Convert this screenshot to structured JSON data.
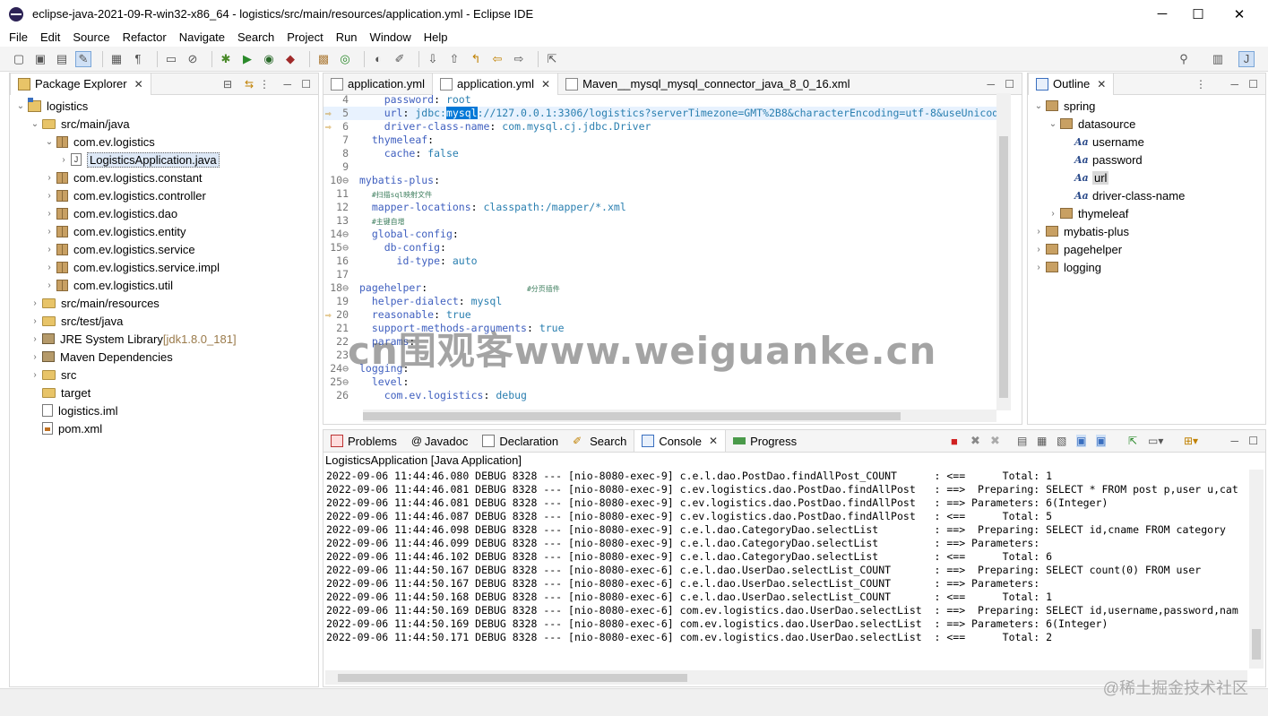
{
  "window": {
    "title": "eclipse-java-2021-09-R-win32-x86_64 - logistics/src/main/resources/application.yml - Eclipse IDE",
    "minimize": "─",
    "maximize": "☐",
    "close": "✕"
  },
  "menu": [
    "File",
    "Edit",
    "Source",
    "Refactor",
    "Navigate",
    "Search",
    "Project",
    "Run",
    "Window",
    "Help"
  ],
  "package_explorer": {
    "title": "Package Explorer",
    "tree": [
      {
        "label": "logistics",
        "kind": "project",
        "depth": 0,
        "twisty": "v"
      },
      {
        "label": "src/main/java",
        "kind": "srcfolder",
        "depth": 1,
        "twisty": "v"
      },
      {
        "label": "com.ev.logistics",
        "kind": "package",
        "depth": 2,
        "twisty": "v"
      },
      {
        "label": "LogisticsApplication.java",
        "kind": "java",
        "depth": 3,
        "twisty": ">",
        "selected": true
      },
      {
        "label": "com.ev.logistics.constant",
        "kind": "package",
        "depth": 2,
        "twisty": ">"
      },
      {
        "label": "com.ev.logistics.controller",
        "kind": "package",
        "depth": 2,
        "twisty": ">"
      },
      {
        "label": "com.ev.logistics.dao",
        "kind": "package",
        "depth": 2,
        "twisty": ">"
      },
      {
        "label": "com.ev.logistics.entity",
        "kind": "package",
        "depth": 2,
        "twisty": ">"
      },
      {
        "label": "com.ev.logistics.service",
        "kind": "package",
        "depth": 2,
        "twisty": ">"
      },
      {
        "label": "com.ev.logistics.service.impl",
        "kind": "package",
        "depth": 2,
        "twisty": ">"
      },
      {
        "label": "com.ev.logistics.util",
        "kind": "package",
        "depth": 2,
        "twisty": ">"
      },
      {
        "label": "src/main/resources",
        "kind": "srcfolder",
        "depth": 1,
        "twisty": ">"
      },
      {
        "label": "src/test/java",
        "kind": "srcfolder",
        "depth": 1,
        "twisty": ">"
      },
      {
        "label": "JRE System Library",
        "suffix": "[jdk1.8.0_181]",
        "kind": "jar",
        "depth": 1,
        "twisty": ">"
      },
      {
        "label": "Maven Dependencies",
        "kind": "jar",
        "depth": 1,
        "twisty": ">"
      },
      {
        "label": "src",
        "kind": "folder",
        "depth": 1,
        "twisty": ">"
      },
      {
        "label": "target",
        "kind": "folder",
        "depth": 1,
        "twisty": ""
      },
      {
        "label": "logistics.iml",
        "kind": "file",
        "depth": 1,
        "twisty": ""
      },
      {
        "label": "pom.xml",
        "kind": "xml",
        "depth": 1,
        "twisty": ""
      }
    ]
  },
  "editor": {
    "tabs": [
      {
        "label": "application.yml",
        "active": false
      },
      {
        "label": "application.yml",
        "active": true
      },
      {
        "label": "Maven__mysql_mysql_connector_java_8_0_16.xml",
        "active": false
      }
    ],
    "lines": [
      {
        "n": "4",
        "parts": [
          [
            "p",
            "    "
          ],
          [
            "k",
            "password"
          ],
          [
            "p",
            ": "
          ],
          [
            "v",
            "root"
          ]
        ]
      },
      {
        "n": "5",
        "marker": true,
        "parts": [
          [
            "p",
            "    "
          ],
          [
            "k",
            "url"
          ],
          [
            "p",
            ": "
          ],
          [
            "v",
            "jdbc:"
          ],
          [
            "hl",
            "mysql"
          ],
          [
            "v",
            "://127.0.0.1:3306/logistics?serverTimezone=GMT%2B8&characterEncoding=utf-8&useUnicode"
          ]
        ]
      },
      {
        "n": "6",
        "marker": true,
        "parts": [
          [
            "p",
            "    "
          ],
          [
            "k",
            "driver-class-name"
          ],
          [
            "p",
            ": "
          ],
          [
            "v",
            "com.mysql.cj.jdbc.Driver"
          ]
        ]
      },
      {
        "n": "7",
        "parts": [
          [
            "p",
            "  "
          ],
          [
            "k",
            "thymeleaf"
          ],
          [
            "p",
            ":"
          ]
        ]
      },
      {
        "n": "8",
        "parts": [
          [
            "p",
            "    "
          ],
          [
            "k",
            "cache"
          ],
          [
            "p",
            ": "
          ],
          [
            "v",
            "false"
          ]
        ]
      },
      {
        "n": "9",
        "parts": []
      },
      {
        "n": "10⊖",
        "parts": [
          [
            "k",
            "mybatis-plus"
          ],
          [
            "p",
            ":"
          ]
        ]
      },
      {
        "n": "11",
        "parts": [
          [
            "p",
            "  "
          ],
          [
            "c",
            "#扫描sql映射文件"
          ]
        ]
      },
      {
        "n": "12",
        "parts": [
          [
            "p",
            "  "
          ],
          [
            "k",
            "mapper-locations"
          ],
          [
            "p",
            ": "
          ],
          [
            "v",
            "classpath:/mapper/*.xml"
          ]
        ]
      },
      {
        "n": "13",
        "parts": [
          [
            "p",
            "  "
          ],
          [
            "c",
            "#主键自增"
          ]
        ]
      },
      {
        "n": "14⊖",
        "parts": [
          [
            "p",
            "  "
          ],
          [
            "k",
            "global-config"
          ],
          [
            "p",
            ":"
          ]
        ]
      },
      {
        "n": "15⊖",
        "parts": [
          [
            "p",
            "    "
          ],
          [
            "k",
            "db-config"
          ],
          [
            "p",
            ":"
          ]
        ]
      },
      {
        "n": "16",
        "parts": [
          [
            "p",
            "      "
          ],
          [
            "k",
            "id-type"
          ],
          [
            "p",
            ": "
          ],
          [
            "v",
            "auto"
          ]
        ]
      },
      {
        "n": "17",
        "parts": []
      },
      {
        "n": "18⊖",
        "parts": [
          [
            "k",
            "pagehelper"
          ],
          [
            "p",
            ":                "
          ],
          [
            "c",
            "#分页插件"
          ]
        ]
      },
      {
        "n": "19",
        "parts": [
          [
            "p",
            "  "
          ],
          [
            "k",
            "helper-dialect"
          ],
          [
            "p",
            ": "
          ],
          [
            "v",
            "mysql"
          ]
        ]
      },
      {
        "n": "20",
        "marker": true,
        "parts": [
          [
            "p",
            "  "
          ],
          [
            "k",
            "reasonable"
          ],
          [
            "p",
            ": "
          ],
          [
            "v",
            "true"
          ]
        ]
      },
      {
        "n": "21",
        "parts": [
          [
            "p",
            "  "
          ],
          [
            "k",
            "support-methods-arguments"
          ],
          [
            "p",
            ": "
          ],
          [
            "v",
            "true"
          ]
        ]
      },
      {
        "n": "22",
        "parts": [
          [
            "p",
            "  "
          ],
          [
            "k",
            "params"
          ],
          [
            "p",
            ":"
          ]
        ]
      },
      {
        "n": "23",
        "parts": []
      },
      {
        "n": "24⊖",
        "parts": [
          [
            "k",
            "logging"
          ],
          [
            "p",
            ":"
          ]
        ]
      },
      {
        "n": "25⊖",
        "parts": [
          [
            "p",
            "  "
          ],
          [
            "k",
            "level"
          ],
          [
            "p",
            ":"
          ]
        ]
      },
      {
        "n": "26",
        "parts": [
          [
            "p",
            "    "
          ],
          [
            "k",
            "com.ev.logistics"
          ],
          [
            "p",
            ": "
          ],
          [
            "v",
            "debug"
          ]
        ]
      }
    ]
  },
  "outline": {
    "title": "Outline",
    "tree": [
      {
        "label": "spring",
        "depth": 0,
        "twisty": "v",
        "kind": "map"
      },
      {
        "label": "datasource",
        "depth": 1,
        "twisty": "v",
        "kind": "map"
      },
      {
        "label": "username",
        "depth": 2,
        "twisty": "",
        "kind": "scalar"
      },
      {
        "label": "password",
        "depth": 2,
        "twisty": "",
        "kind": "scalar"
      },
      {
        "label": "url",
        "depth": 2,
        "twisty": "",
        "kind": "scalar",
        "selected": true
      },
      {
        "label": "driver-class-name",
        "depth": 2,
        "twisty": "",
        "kind": "scalar"
      },
      {
        "label": "thymeleaf",
        "depth": 1,
        "twisty": ">",
        "kind": "map"
      },
      {
        "label": "mybatis-plus",
        "depth": 0,
        "twisty": ">",
        "kind": "map"
      },
      {
        "label": "pagehelper",
        "depth": 0,
        "twisty": ">",
        "kind": "map"
      },
      {
        "label": "logging",
        "depth": 0,
        "twisty": ">",
        "kind": "map"
      }
    ]
  },
  "bottom": {
    "tabs": [
      "Problems",
      "Javadoc",
      "Declaration",
      "Search",
      "Console",
      "Progress"
    ],
    "active_tab": "Console",
    "launch": "LogisticsApplication [Java Application]",
    "lines": [
      "2022-09-06 11:44:46.080 DEBUG 8328 --- [nio-8080-exec-9] c.e.l.dao.PostDao.findAllPost_COUNT      : <==      Total: 1",
      "2022-09-06 11:44:46.081 DEBUG 8328 --- [nio-8080-exec-9] c.ev.logistics.dao.PostDao.findAllPost   : ==>  Preparing: SELECT * FROM post p,user u,cat",
      "2022-09-06 11:44:46.081 DEBUG 8328 --- [nio-8080-exec-9] c.ev.logistics.dao.PostDao.findAllPost   : ==> Parameters: 6(Integer)",
      "2022-09-06 11:44:46.087 DEBUG 8328 --- [nio-8080-exec-9] c.ev.logistics.dao.PostDao.findAllPost   : <==      Total: 5",
      "2022-09-06 11:44:46.098 DEBUG 8328 --- [nio-8080-exec-9] c.e.l.dao.CategoryDao.selectList         : ==>  Preparing: SELECT id,cname FROM category",
      "2022-09-06 11:44:46.099 DEBUG 8328 --- [nio-8080-exec-9] c.e.l.dao.CategoryDao.selectList         : ==> Parameters: ",
      "2022-09-06 11:44:46.102 DEBUG 8328 --- [nio-8080-exec-9] c.e.l.dao.CategoryDao.selectList         : <==      Total: 6",
      "2022-09-06 11:44:50.167 DEBUG 8328 --- [nio-8080-exec-6] c.e.l.dao.UserDao.selectList_COUNT       : ==>  Preparing: SELECT count(0) FROM user",
      "2022-09-06 11:44:50.167 DEBUG 8328 --- [nio-8080-exec-6] c.e.l.dao.UserDao.selectList_COUNT       : ==> Parameters: ",
      "2022-09-06 11:44:50.168 DEBUG 8328 --- [nio-8080-exec-6] c.e.l.dao.UserDao.selectList_COUNT       : <==      Total: 1",
      "2022-09-06 11:44:50.169 DEBUG 8328 --- [nio-8080-exec-6] com.ev.logistics.dao.UserDao.selectList  : ==>  Preparing: SELECT id,username,password,nam",
      "2022-09-06 11:44:50.169 DEBUG 8328 --- [nio-8080-exec-6] com.ev.logistics.dao.UserDao.selectList  : ==> Parameters: 6(Integer)",
      "2022-09-06 11:44:50.171 DEBUG 8328 --- [nio-8080-exec-6] com.ev.logistics.dao.UserDao.selectList  : <==      Total: 2"
    ]
  },
  "watermarks": {
    "center": "cn围观客www.weiguanke.cn",
    "corner": "@稀土掘金技术社区"
  },
  "colors": {
    "selection": "#0078d7",
    "key": "#3f5fbf",
    "value": "#2a7fb0",
    "comment": "#3f7f5f",
    "marker": "#c08000"
  }
}
